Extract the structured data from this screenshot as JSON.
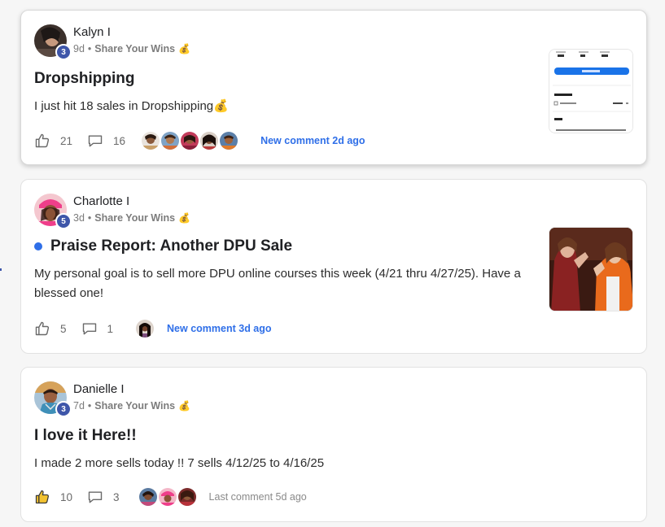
{
  "posts": [
    {
      "author": "Kalyn I",
      "level": "3",
      "time": "9d",
      "category": "Share Your Wins",
      "category_emoji": "💰",
      "title": "Dropshipping",
      "body": "I just hit 18 sales in Dropshipping💰",
      "likes": "21",
      "comments": "16",
      "comment_status": "New comment 2d ago",
      "status_type": "new"
    },
    {
      "author": "Charlotte I",
      "level": "5",
      "time": "3d",
      "category": "Share Your Wins",
      "category_emoji": "💰",
      "title": "Praise Report: Another DPU Sale",
      "body": "My personal goal is to sell more DPU online courses this week (4/21 thru 4/27/25). Have a blessed one!",
      "likes": "5",
      "comments": "1",
      "comment_status": "New comment 3d ago",
      "status_type": "new"
    },
    {
      "author": "Danielle I",
      "level": "3",
      "time": "7d",
      "category": "Share Your Wins",
      "category_emoji": "💰",
      "title": "I love it Here!!",
      "body": "I made 2 more sells today !! 7 sells 4/12/25 to 4/16/25",
      "likes": "10",
      "comments": "3",
      "comment_status": "Last comment 5d ago",
      "status_type": "last"
    }
  ],
  "icons": {
    "like": "thumbs-up-icon",
    "comment": "speech-bubble-icon",
    "category": "money-bag-icon"
  },
  "colors": {
    "accent": "#2f6fe8",
    "level_badge": "#3e56a9",
    "liked": "#f2c230",
    "muted": "#7c7c7c"
  }
}
